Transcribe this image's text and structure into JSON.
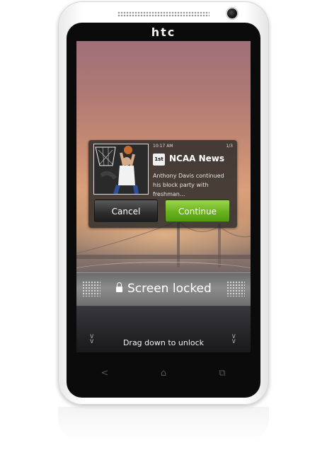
{
  "device": {
    "brand": "htc"
  },
  "notification": {
    "time": "10:17 AM",
    "count": "1/3",
    "source_logo_text": "1st",
    "title": "NCAA News",
    "summary": "Anthony Davis continued his block party with freshman..."
  },
  "actions": {
    "cancel_label": "Cancel",
    "continue_label": "Continue"
  },
  "lock": {
    "status": "Screen locked",
    "hint": "Drag down to unlock"
  },
  "colors": {
    "continue": "#6bb21f",
    "cancel": "#2d2d2d",
    "screen_top": "#9f6f79",
    "screen_mid": "#d9a07a"
  },
  "icons": {
    "lock": "lock-icon",
    "back": "back-icon",
    "home": "home-icon",
    "recent": "recent-apps-icon"
  }
}
